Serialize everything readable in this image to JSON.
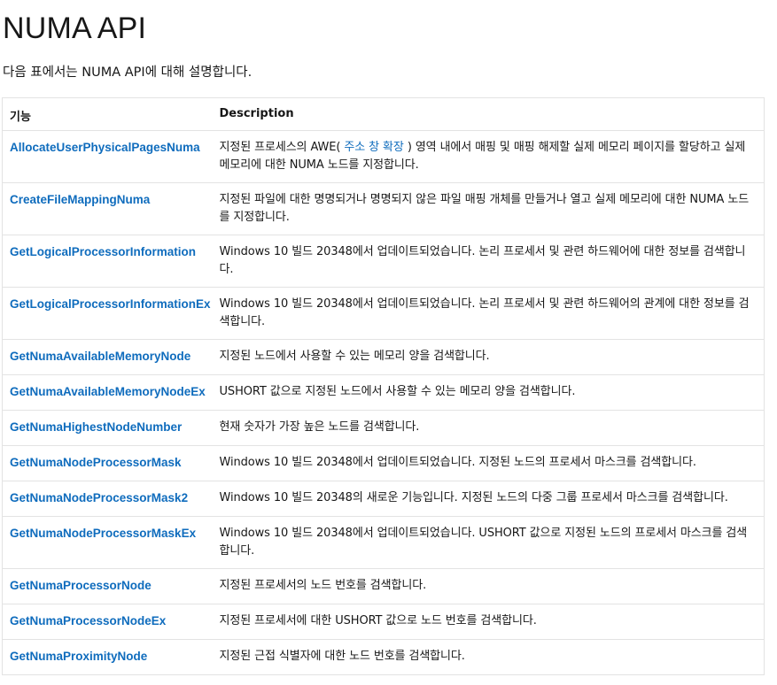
{
  "page": {
    "title": "NUMA API",
    "intro": "다음 표에서는 NUMA API에 대해 설명합니다."
  },
  "table": {
    "headers": [
      "기능",
      "Description"
    ],
    "rows": [
      {
        "name": "AllocateUserPhysicalPagesNuma",
        "desc_before": "지정된 프로세스의 AWE( ",
        "desc_link": "주소 창 확장",
        "desc_after": " ) 영역 내에서 매핑 및 매핑 해제할 실제 메모리 페이지를 할당하고 실제 메모리에 대한 NUMA 노드를 지정합니다."
      },
      {
        "name": "CreateFileMappingNuma",
        "desc": "지정된 파일에 대한 명명되거나 명명되지 않은 파일 매핑 개체를 만들거나 열고 실제 메모리에 대한 NUMA 노드를 지정합니다."
      },
      {
        "name": "GetLogicalProcessorInformation",
        "desc": "Windows 10 빌드 20348에서 업데이트되었습니다. 논리 프로세서 및 관련 하드웨어에 대한 정보를 검색합니다."
      },
      {
        "name": "GetLogicalProcessorInformationEx",
        "desc": "Windows 10 빌드 20348에서 업데이트되었습니다. 논리 프로세서 및 관련 하드웨어의 관계에 대한 정보를 검색합니다."
      },
      {
        "name": "GetNumaAvailableMemoryNode",
        "desc": "지정된 노드에서 사용할 수 있는 메모리 양을 검색합니다."
      },
      {
        "name": "GetNumaAvailableMemoryNodeEx",
        "desc": "USHORT 값으로 지정된 노드에서 사용할 수 있는 메모리 양을 검색합니다."
      },
      {
        "name": "GetNumaHighestNodeNumber",
        "desc": "현재 숫자가 가장 높은 노드를 검색합니다."
      },
      {
        "name": "GetNumaNodeProcessorMask",
        "desc": "Windows 10 빌드 20348에서 업데이트되었습니다. 지정된 노드의 프로세서 마스크를 검색합니다."
      },
      {
        "name": "GetNumaNodeProcessorMask2",
        "desc": "Windows 10 빌드 20348의 새로운 기능입니다. 지정된 노드의 다중 그룹 프로세서 마스크를 검색합니다."
      },
      {
        "name": "GetNumaNodeProcessorMaskEx",
        "desc": "Windows 10 빌드 20348에서 업데이트되었습니다. USHORT 값으로 지정된 노드의 프로세서 마스크를 검색합니다."
      },
      {
        "name": "GetNumaProcessorNode",
        "desc": "지정된 프로세서의 노드 번호를 검색합니다."
      },
      {
        "name": "GetNumaProcessorNodeEx",
        "desc": "지정된 프로세서에 대한 USHORT 값으로 노드 번호를 검색합니다."
      },
      {
        "name": "GetNumaProximityNode",
        "desc": "지정된 근접 식별자에 대한 노드 번호를 검색합니다."
      }
    ]
  },
  "colors": {
    "link": "#0f6cbd",
    "text": "#171717",
    "border": "#e3e3e3"
  }
}
